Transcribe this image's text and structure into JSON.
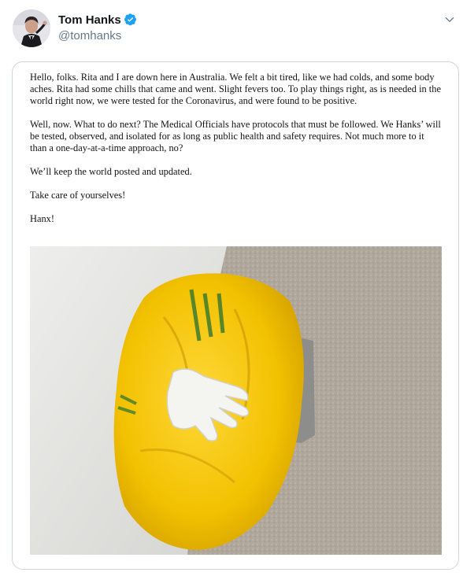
{
  "tweet": {
    "author_name": "Tom Hanks",
    "handle": "@tomhanks",
    "verified": true,
    "icons": {
      "verified": "verified-badge-icon",
      "menu": "chevron-down-icon"
    },
    "accent_color": "#1da1f2"
  },
  "note": {
    "paragraphs": [
      "Hello, folks. Rita and I are down here in Australia. We felt a bit tired, like we had colds, and some body aches. Rita had some chills that came and went. Slight fevers too. To play things right, as is needed in the world right now, we were tested for the Coronavirus, and were found to be positive.",
      "Well, now. What to do next? The Medical Officials have protocols that must be followed. We Hanks’ will be tested, observed, and isolated for as long as public health and safety requires.  Not much more to it than a one-day-at-a-time approach, no?",
      "We’ll keep the world posted and updated.",
      "Take care of yourselves!",
      "Hanx!"
    ]
  }
}
